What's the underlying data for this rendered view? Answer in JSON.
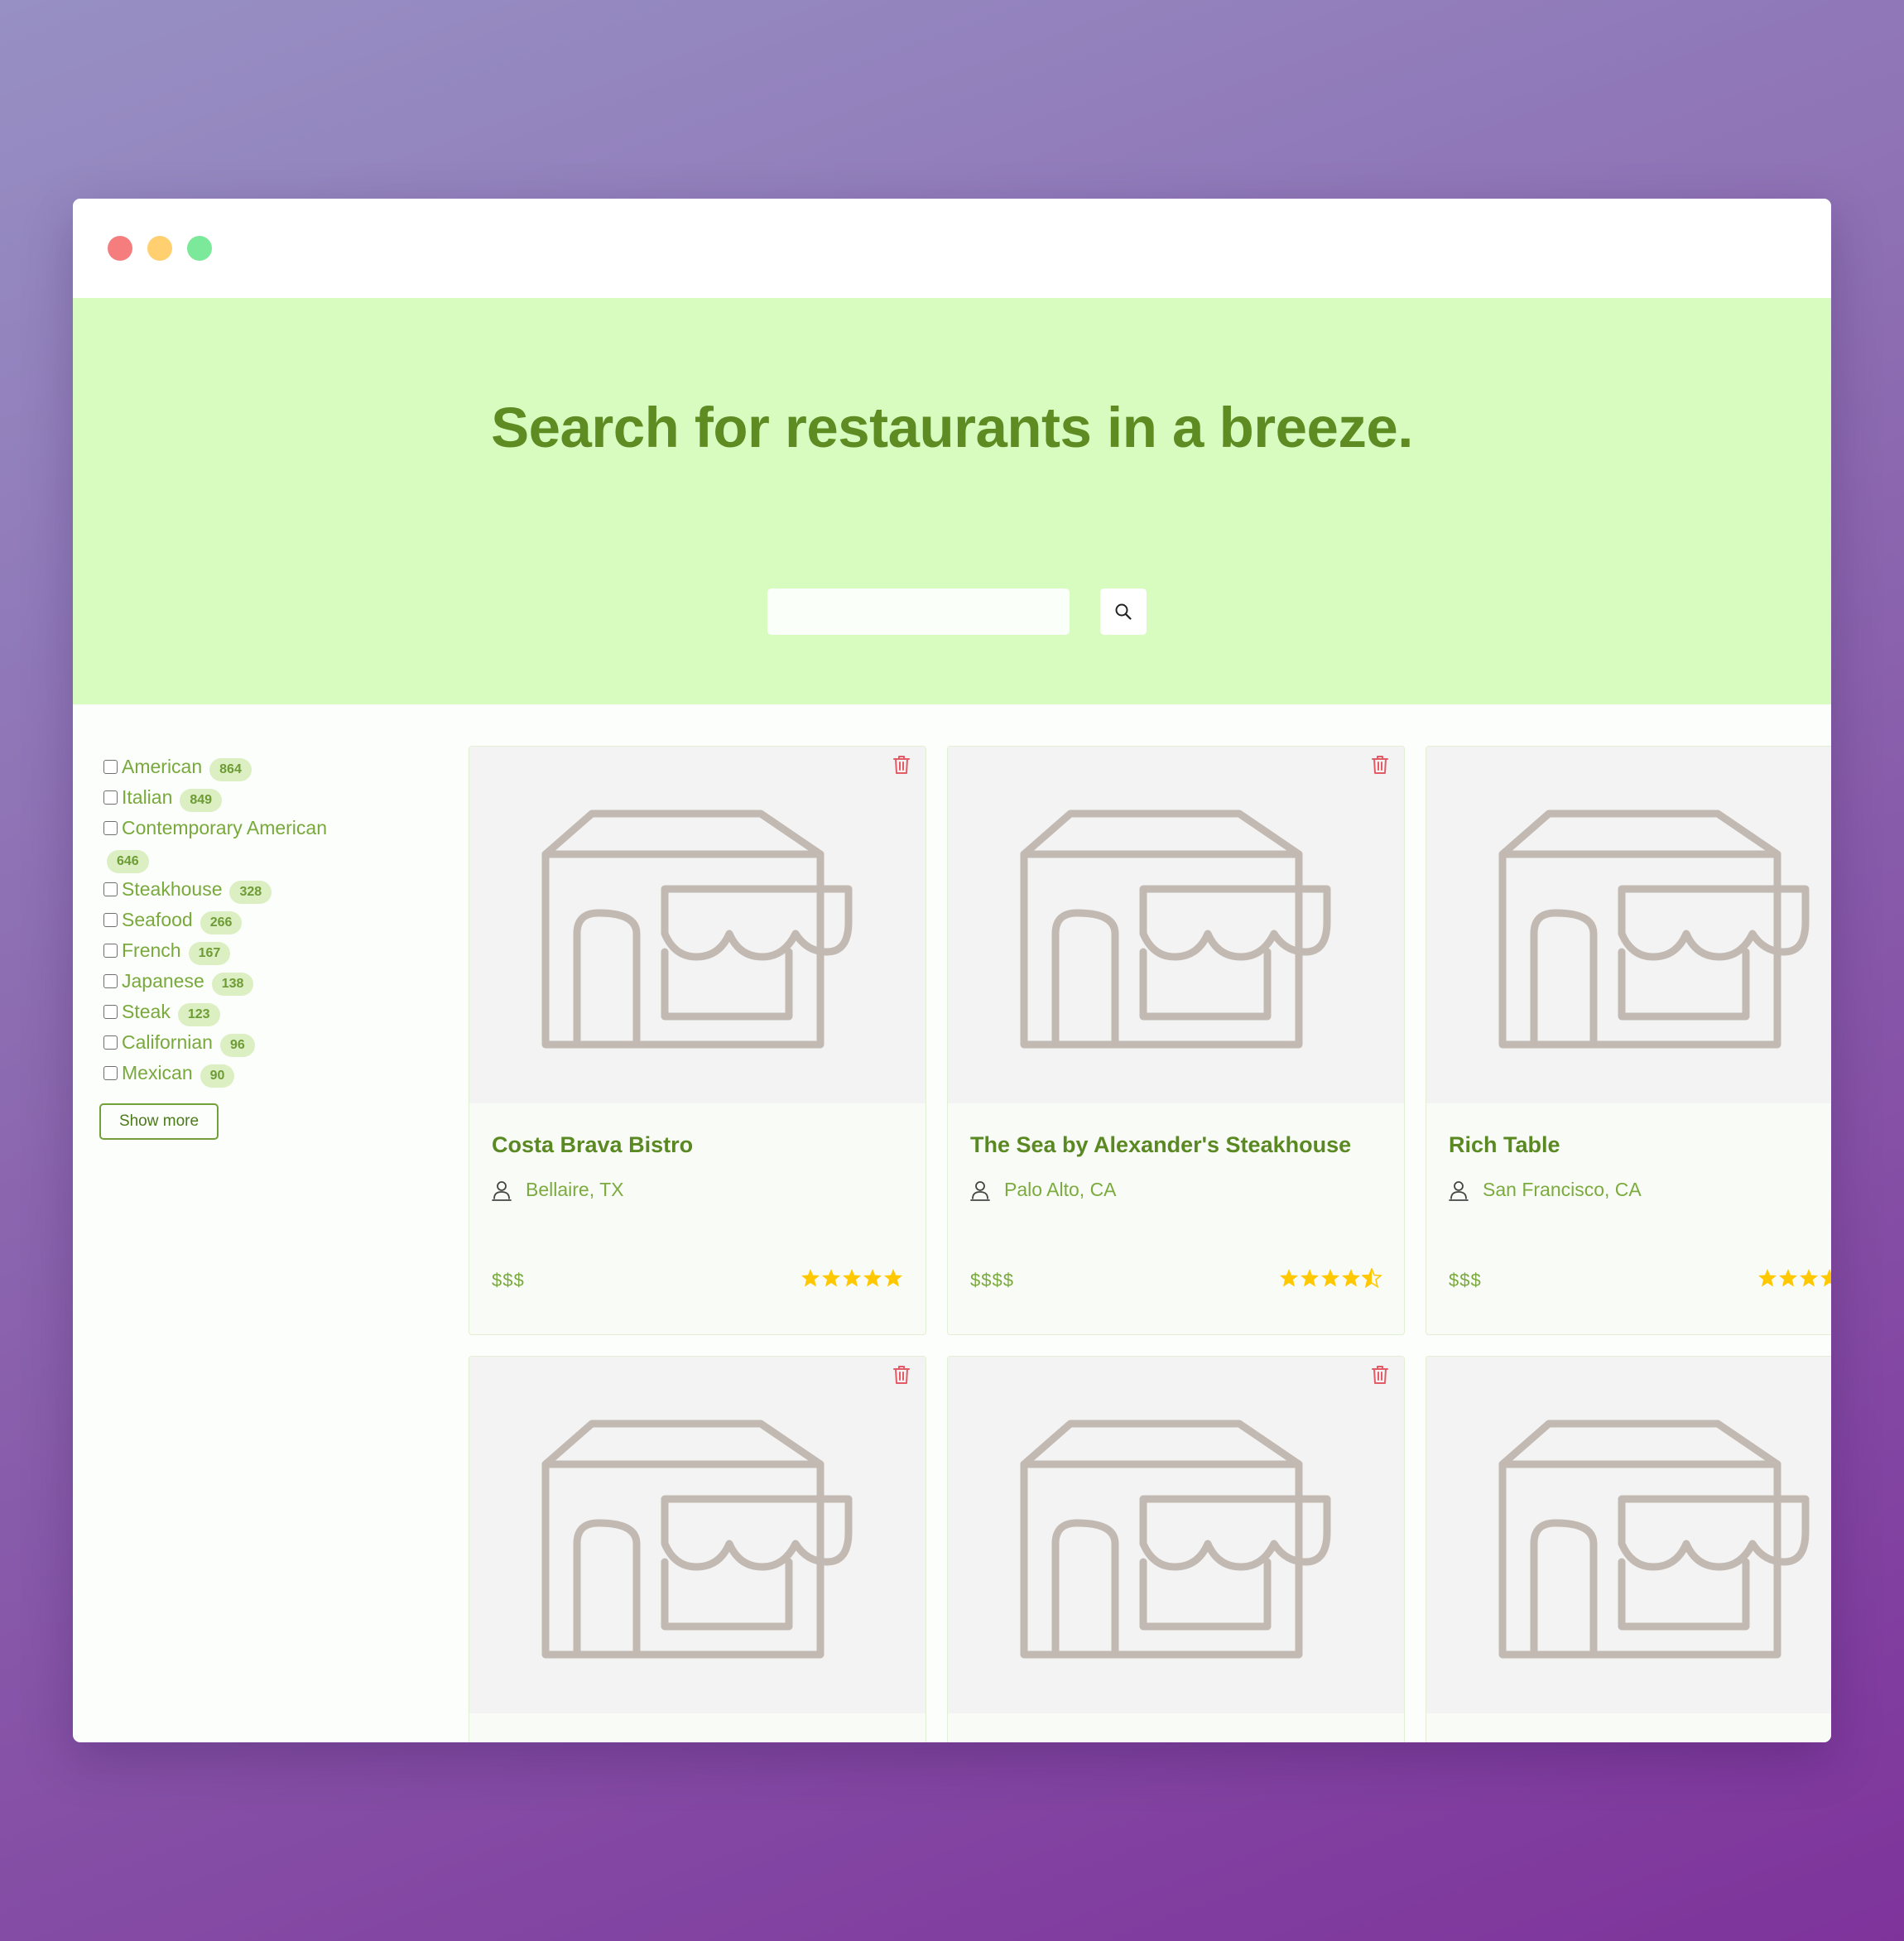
{
  "window": {
    "controls": [
      {
        "name": "close",
        "color": "#f57d7e"
      },
      {
        "name": "minimize",
        "color": "#ffcf70"
      },
      {
        "name": "maximize",
        "color": "#7ce89a"
      }
    ]
  },
  "hero": {
    "title": "Search for restaurants in a breeze.",
    "search": {
      "value": "",
      "placeholder": "",
      "button_icon": "search-icon"
    }
  },
  "filters": {
    "items": [
      {
        "label": "American",
        "count": "864",
        "checked": false
      },
      {
        "label": "Italian",
        "count": "849",
        "checked": false
      },
      {
        "label": "Contemporary American",
        "count": "646",
        "checked": false
      },
      {
        "label": "Steakhouse",
        "count": "328",
        "checked": false
      },
      {
        "label": "Seafood",
        "count": "266",
        "checked": false
      },
      {
        "label": "French",
        "count": "167",
        "checked": false
      },
      {
        "label": "Japanese",
        "count": "138",
        "checked": false
      },
      {
        "label": "Steak",
        "count": "123",
        "checked": false
      },
      {
        "label": "Californian",
        "count": "96",
        "checked": false
      },
      {
        "label": "Mexican",
        "count": "90",
        "checked": false
      }
    ],
    "show_more_label": "Show more"
  },
  "results": [
    {
      "name": "Costa Brava Bistro",
      "location": "Bellaire, TX",
      "price": "$$$",
      "rating": 5
    },
    {
      "name": "The Sea by Alexander's Steakhouse",
      "location": "Palo Alto, CA",
      "price": "$$$$",
      "rating": 4.5
    },
    {
      "name": "Rich Table",
      "location": "San Francisco, CA",
      "price": "$$$",
      "rating": 5
    },
    {
      "name": "",
      "location": "",
      "price": "",
      "rating": null
    },
    {
      "name": "",
      "location": "",
      "price": "",
      "rating": null
    },
    {
      "name": "",
      "location": "",
      "price": "",
      "rating": null
    }
  ],
  "colors": {
    "hero_background": "#d8fcc0",
    "brand_green": "#5e8c23",
    "star": "#ffc800",
    "trash": "#e35b66",
    "placeholder_icon": "#c2bab2"
  },
  "icons": {
    "card_image": "storefront-icon",
    "delete": "trash-icon",
    "location": "user-pin-icon",
    "rating": "star-icon"
  }
}
